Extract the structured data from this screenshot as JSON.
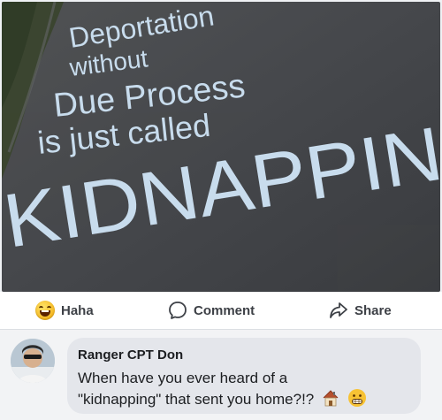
{
  "post": {
    "chalk_lines": [
      "Deportation",
      "without",
      "Due Process",
      "is just called",
      "KIDNAPPIN"
    ],
    "chalk_color": "#c8dced"
  },
  "actions": {
    "haha_label": "Haha",
    "comment_label": "Comment",
    "share_label": "Share",
    "haha_icon": "haha-emoji-icon",
    "comment_icon": "speech-bubble-icon",
    "share_icon": "share-arrow-icon"
  },
  "comment": {
    "author": "Ranger CPT Don",
    "text_line1": "When have you ever heard of a",
    "text_line2": "\"kidnapping\" that sent you home?!?",
    "emojis": [
      "house-icon",
      "grimace-emoji-icon"
    ]
  },
  "colors": {
    "action_text": "#3d4046",
    "bubble_bg": "#e4e6eb",
    "asphalt": "#4a4c50"
  }
}
